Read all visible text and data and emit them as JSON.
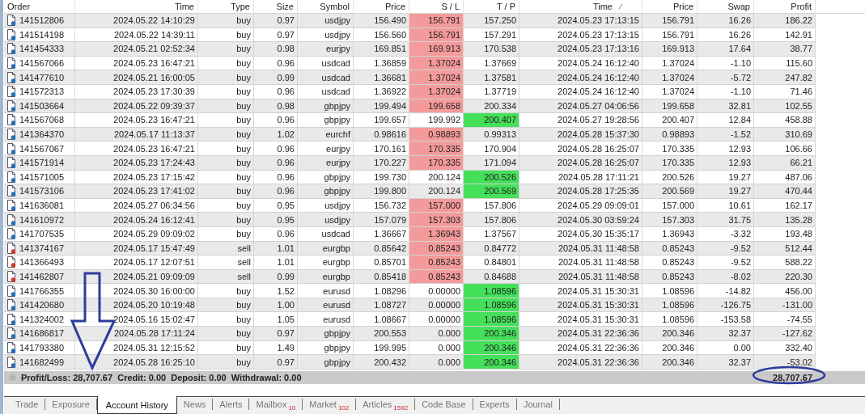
{
  "table": {
    "columns": [
      {
        "label": "Order",
        "sorted": false
      },
      {
        "label": "Time",
        "sorted": false
      },
      {
        "label": "Type",
        "sorted": false
      },
      {
        "label": "Size",
        "sorted": false
      },
      {
        "label": "Symbol",
        "sorted": false
      },
      {
        "label": "Price",
        "sorted": false
      },
      {
        "label": "S / L",
        "sorted": false
      },
      {
        "label": "T / P",
        "sorted": false
      },
      {
        "label": "Time",
        "sorted": true
      },
      {
        "label": "Price",
        "sorted": false
      },
      {
        "label": "Swap",
        "sorted": false
      },
      {
        "label": "Profit",
        "sorted": false
      }
    ],
    "rows": [
      {
        "kind": "buy",
        "order": "141512806",
        "open_time": "2024.05.22 14:10:29",
        "type": "buy",
        "size": "0.97",
        "symbol": "usdjpy",
        "price": "156.490",
        "sl": "156.791",
        "sl_hit": true,
        "tp": "157.250",
        "tp_hit": false,
        "close_time": "2024.05.23 17:13:15",
        "close_price": "156.791",
        "swap": "16.26",
        "profit": "186.22"
      },
      {
        "kind": "buy",
        "order": "141514198",
        "open_time": "2024.05.22 14:39:11",
        "type": "buy",
        "size": "0.97",
        "symbol": "usdjpy",
        "price": "156.560",
        "sl": "156.791",
        "sl_hit": true,
        "tp": "157.291",
        "tp_hit": false,
        "close_time": "2024.05.23 17:13:15",
        "close_price": "156.791",
        "swap": "16.26",
        "profit": "142.91"
      },
      {
        "kind": "buy",
        "order": "141454333",
        "open_time": "2024.05.21 02:52:34",
        "type": "buy",
        "size": "0.98",
        "symbol": "eurjpy",
        "price": "169.851",
        "sl": "169.913",
        "sl_hit": true,
        "tp": "170.538",
        "tp_hit": false,
        "close_time": "2024.05.23 17:13:16",
        "close_price": "169.913",
        "swap": "17.64",
        "profit": "38.77"
      },
      {
        "kind": "buy",
        "order": "141567066",
        "open_time": "2024.05.23 16:47:21",
        "type": "buy",
        "size": "0.96",
        "symbol": "usdcad",
        "price": "1.36859",
        "sl": "1.37024",
        "sl_hit": true,
        "tp": "1.37669",
        "tp_hit": false,
        "close_time": "2024.05.24 16:12:40",
        "close_price": "1.37024",
        "swap": "-1.10",
        "profit": "115.60"
      },
      {
        "kind": "buy",
        "order": "141477610",
        "open_time": "2024.05.21 16:00:05",
        "type": "buy",
        "size": "0.99",
        "symbol": "usdcad",
        "price": "1.36681",
        "sl": "1.37024",
        "sl_hit": true,
        "tp": "1.37581",
        "tp_hit": false,
        "close_time": "2024.05.24 16:12:40",
        "close_price": "1.37024",
        "swap": "-5.72",
        "profit": "247.82"
      },
      {
        "kind": "buy",
        "order": "141572313",
        "open_time": "2024.05.23 17:30:39",
        "type": "buy",
        "size": "0.96",
        "symbol": "usdcad",
        "price": "1.36922",
        "sl": "1.37024",
        "sl_hit": true,
        "tp": "1.37719",
        "tp_hit": false,
        "close_time": "2024.05.24 16:12:40",
        "close_price": "1.37024",
        "swap": "-1.10",
        "profit": "71.46"
      },
      {
        "kind": "buy",
        "order": "141503664",
        "open_time": "2024.05.22 09:39:37",
        "type": "buy",
        "size": "0.98",
        "symbol": "gbpjpy",
        "price": "199.494",
        "sl": "199.658",
        "sl_hit": true,
        "tp": "200.334",
        "tp_hit": false,
        "close_time": "2024.05.27 04:06:56",
        "close_price": "199.658",
        "swap": "32.81",
        "profit": "102.55"
      },
      {
        "kind": "buy",
        "order": "141567068",
        "open_time": "2024.05.23 16:47:21",
        "type": "buy",
        "size": "0.96",
        "symbol": "gbpjpy",
        "price": "199.657",
        "sl": "199.992",
        "sl_hit": false,
        "tp": "200.407",
        "tp_hit": true,
        "close_time": "2024.05.27 19:28:56",
        "close_price": "200.407",
        "swap": "12.84",
        "profit": "458.88"
      },
      {
        "kind": "buy",
        "order": "141364370",
        "open_time": "2024.05.17 11:13:37",
        "type": "buy",
        "size": "1.02",
        "symbol": "eurchf",
        "price": "0.98616",
        "sl": "0.98893",
        "sl_hit": true,
        "tp": "0.99313",
        "tp_hit": false,
        "close_time": "2024.05.28 15:37:30",
        "close_price": "0.98893",
        "swap": "-1.52",
        "profit": "310.69"
      },
      {
        "kind": "buy",
        "order": "141567067",
        "open_time": "2024.05.23 16:47:21",
        "type": "buy",
        "size": "0.96",
        "symbol": "eurjpy",
        "price": "170.161",
        "sl": "170.335",
        "sl_hit": true,
        "tp": "170.904",
        "tp_hit": false,
        "close_time": "2024.05.28 16:25:07",
        "close_price": "170.335",
        "swap": "12.93",
        "profit": "106.66"
      },
      {
        "kind": "buy",
        "order": "141571914",
        "open_time": "2024.05.23 17:24:43",
        "type": "buy",
        "size": "0.96",
        "symbol": "eurjpy",
        "price": "170.227",
        "sl": "170.335",
        "sl_hit": true,
        "tp": "171.094",
        "tp_hit": false,
        "close_time": "2024.05.28 16:25:07",
        "close_price": "170.335",
        "swap": "12.93",
        "profit": "66.21"
      },
      {
        "kind": "buy",
        "order": "141571005",
        "open_time": "2024.05.23 17:15:42",
        "type": "buy",
        "size": "0.96",
        "symbol": "gbpjpy",
        "price": "199.730",
        "sl": "200.124",
        "sl_hit": false,
        "tp": "200.526",
        "tp_hit": true,
        "close_time": "2024.05.28 17:11:21",
        "close_price": "200.526",
        "swap": "19.27",
        "profit": "487.06"
      },
      {
        "kind": "buy",
        "order": "141573106",
        "open_time": "2024.05.23 17:41:02",
        "type": "buy",
        "size": "0.96",
        "symbol": "gbpjpy",
        "price": "199.800",
        "sl": "200.124",
        "sl_hit": false,
        "tp": "200.569",
        "tp_hit": true,
        "close_time": "2024.05.28 17:25:35",
        "close_price": "200.569",
        "swap": "19.27",
        "profit": "470.44"
      },
      {
        "kind": "buy",
        "order": "141636081",
        "open_time": "2024.05.27 06:34:56",
        "type": "buy",
        "size": "0.95",
        "symbol": "usdjpy",
        "price": "156.732",
        "sl": "157.000",
        "sl_hit": true,
        "tp": "157.806",
        "tp_hit": false,
        "close_time": "2024.05.29 09:09:01",
        "close_price": "157.000",
        "swap": "10.61",
        "profit": "162.17"
      },
      {
        "kind": "buy",
        "order": "141610972",
        "open_time": "2024.05.24 16:12:41",
        "type": "buy",
        "size": "0.95",
        "symbol": "usdjpy",
        "price": "157.079",
        "sl": "157.303",
        "sl_hit": true,
        "tp": "157.806",
        "tp_hit": false,
        "close_time": "2024.05.30 03:59:24",
        "close_price": "157.303",
        "swap": "31.75",
        "profit": "135.28"
      },
      {
        "kind": "buy",
        "order": "141707535",
        "open_time": "2024.05.29 09:09:02",
        "type": "buy",
        "size": "0.96",
        "symbol": "usdcad",
        "price": "1.36667",
        "sl": "1.36943",
        "sl_hit": true,
        "tp": "1.37567",
        "tp_hit": false,
        "close_time": "2024.05.30 15:35:17",
        "close_price": "1.36943",
        "swap": "-3.32",
        "profit": "193.48"
      },
      {
        "kind": "sell",
        "order": "141374167",
        "open_time": "2024.05.17 15:47:49",
        "type": "sell",
        "size": "1.01",
        "symbol": "eurgbp",
        "price": "0.85642",
        "sl": "0.85243",
        "sl_hit": true,
        "tp": "0.84772",
        "tp_hit": false,
        "close_time": "2024.05.31 11:48:58",
        "close_price": "0.85243",
        "swap": "-9.52",
        "profit": "512.44"
      },
      {
        "kind": "sell",
        "order": "141366493",
        "open_time": "2024.05.17 12:07:51",
        "type": "sell",
        "size": "1.01",
        "symbol": "eurgbp",
        "price": "0.85701",
        "sl": "0.85243",
        "sl_hit": true,
        "tp": "0.84801",
        "tp_hit": false,
        "close_time": "2024.05.31 11:48:58",
        "close_price": "0.85243",
        "swap": "-9.52",
        "profit": "588.22"
      },
      {
        "kind": "sell",
        "order": "141462807",
        "open_time": "2024.05.21 09:09:09",
        "type": "sell",
        "size": "0.99",
        "symbol": "eurgbp",
        "price": "0.85418",
        "sl": "0.85243",
        "sl_hit": true,
        "tp": "0.84688",
        "tp_hit": false,
        "close_time": "2024.05.31 11:48:58",
        "close_price": "0.85243",
        "swap": "-8.02",
        "profit": "220.30"
      },
      {
        "kind": "buy",
        "order": "141766355",
        "open_time": "2024.05.30 16:00:00",
        "type": "buy",
        "size": "1.52",
        "symbol": "eurusd",
        "price": "1.08296",
        "sl": "0.00000",
        "sl_hit": false,
        "tp": "1.08596",
        "tp_hit": true,
        "close_time": "2024.05.31 15:30:31",
        "close_price": "1.08596",
        "swap": "-14.82",
        "profit": "456.00"
      },
      {
        "kind": "buy",
        "order": "141420680",
        "open_time": "2024.05.20 10:19:48",
        "type": "buy",
        "size": "1.00",
        "symbol": "eurusd",
        "price": "1.08727",
        "sl": "0.00000",
        "sl_hit": false,
        "tp": "1.08596",
        "tp_hit": true,
        "close_time": "2024.05.31 15:30:31",
        "close_price": "1.08596",
        "swap": "-126.75",
        "profit": "-131.00"
      },
      {
        "kind": "buy",
        "order": "141324002",
        "open_time": "2024.05.16 15:02:47",
        "type": "buy",
        "size": "1.05",
        "symbol": "eurusd",
        "price": "1.08667",
        "sl": "0.00000",
        "sl_hit": false,
        "tp": "1.08596",
        "tp_hit": true,
        "close_time": "2024.05.31 15:30:31",
        "close_price": "1.08596",
        "swap": "-153.58",
        "profit": "-74.55"
      },
      {
        "kind": "buy",
        "order": "141686817",
        "open_time": "2024.05.28 17:11:24",
        "type": "buy",
        "size": "0.97",
        "symbol": "gbpjpy",
        "price": "200.553",
        "sl": "0.000",
        "sl_hit": false,
        "tp": "200.346",
        "tp_hit": true,
        "close_time": "2024.05.31 22:36:36",
        "close_price": "200.346",
        "swap": "32.37",
        "profit": "-127.62"
      },
      {
        "kind": "buy",
        "order": "141793380",
        "open_time": "2024.05.31 12:15:52",
        "type": "buy",
        "size": "1.49",
        "symbol": "gbpjpy",
        "price": "199.995",
        "sl": "0.000",
        "sl_hit": false,
        "tp": "200.346",
        "tp_hit": true,
        "close_time": "2024.05.31 22:36:36",
        "close_price": "200.346",
        "swap": "0.00",
        "profit": "332.40"
      },
      {
        "kind": "buy",
        "order": "141682499",
        "open_time": "2024.05.28 16:25:10",
        "type": "buy",
        "size": "0.97",
        "symbol": "gbpjpy",
        "price": "200.432",
        "sl": "0.000",
        "sl_hit": false,
        "tp": "200.346",
        "tp_hit": true,
        "close_time": "2024.05.31 22:36:36",
        "close_price": "200.346",
        "swap": "32.37",
        "profit": "-53.02"
      }
    ]
  },
  "summary": {
    "text": "Profit/Loss: 28,707.67  Credit: 0.00  Deposit: 0.00  Withdrawal: 0.00",
    "total": "28,707.67"
  },
  "tabs": [
    {
      "label": "Trade",
      "selected": false
    },
    {
      "label": "Exposure",
      "selected": false
    },
    {
      "label": "Account History",
      "selected": true
    },
    {
      "label": "News",
      "selected": false
    },
    {
      "label": "Alerts",
      "selected": false
    },
    {
      "label": "Mailbox",
      "badge": "10",
      "selected": false
    },
    {
      "label": "Market",
      "badge": "102",
      "selected": false
    },
    {
      "label": "Articles",
      "badge": "1592",
      "selected": false
    },
    {
      "label": "Code Base",
      "selected": false
    },
    {
      "label": "Experts",
      "selected": false
    },
    {
      "label": "Journal",
      "selected": false
    }
  ]
}
